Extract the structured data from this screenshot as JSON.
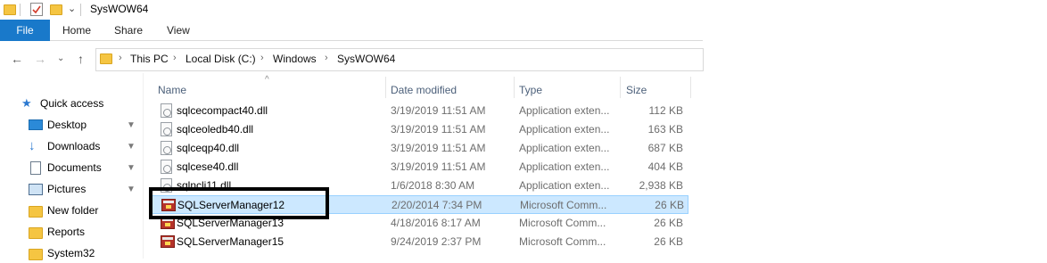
{
  "window": {
    "title": "SysWOW64"
  },
  "ribbon": {
    "tabs": [
      "File",
      "Home",
      "Share",
      "View"
    ]
  },
  "address": {
    "crumbs": [
      "This PC",
      "Local Disk (C:)",
      "Windows",
      "SysWOW64"
    ],
    "separator": "›"
  },
  "nav": {
    "back": "←",
    "forward": "→",
    "up": "↑",
    "dropdown": "⌄"
  },
  "sidebar": {
    "items": [
      {
        "label": "Quick access",
        "icon": "star-icon",
        "pinned": false
      },
      {
        "label": "Desktop",
        "icon": "desktop-icon",
        "pinned": true
      },
      {
        "label": "Downloads",
        "icon": "download-icon",
        "pinned": true
      },
      {
        "label": "Documents",
        "icon": "documents-icon",
        "pinned": true
      },
      {
        "label": "Pictures",
        "icon": "pictures-icon",
        "pinned": true
      },
      {
        "label": "New folder",
        "icon": "folder-icon",
        "pinned": false
      },
      {
        "label": "Reports",
        "icon": "folder-icon",
        "pinned": false
      },
      {
        "label": "System32",
        "icon": "folder-icon",
        "pinned": false
      }
    ],
    "pin_glyph": "📌"
  },
  "columns": {
    "name": "Name",
    "date": "Date modified",
    "type": "Type",
    "size": "Size",
    "sort_glyph": "^"
  },
  "files": [
    {
      "name": "sqlcecompact40.dll",
      "date": "3/19/2019 11:51 AM",
      "type": "Application exten...",
      "size": "112 KB",
      "icon": "dll-icon"
    },
    {
      "name": "sqlceoledb40.dll",
      "date": "3/19/2019 11:51 AM",
      "type": "Application exten...",
      "size": "163 KB",
      "icon": "dll-icon"
    },
    {
      "name": "sqlceqp40.dll",
      "date": "3/19/2019 11:51 AM",
      "type": "Application exten...",
      "size": "687 KB",
      "icon": "dll-icon"
    },
    {
      "name": "sqlcese40.dll",
      "date": "3/19/2019 11:51 AM",
      "type": "Application exten...",
      "size": "404 KB",
      "icon": "dll-icon"
    },
    {
      "name": "sqlncli11.dll",
      "date": "1/6/2018 8:30 AM",
      "type": "Application exten...",
      "size": "2,938 KB",
      "icon": "dll-icon"
    },
    {
      "name": "SQLServerManager12",
      "date": "2/20/2014 7:34 PM",
      "type": "Microsoft Comm...",
      "size": "26 KB",
      "icon": "mmc-icon",
      "selected": true
    },
    {
      "name": "SQLServerManager13",
      "date": "4/18/2016 8:17 AM",
      "type": "Microsoft Comm...",
      "size": "26 KB",
      "icon": "mmc-icon"
    },
    {
      "name": "SQLServerManager15",
      "date": "9/24/2019 2:37 PM",
      "type": "Microsoft Comm...",
      "size": "26 KB",
      "icon": "mmc-icon"
    }
  ]
}
